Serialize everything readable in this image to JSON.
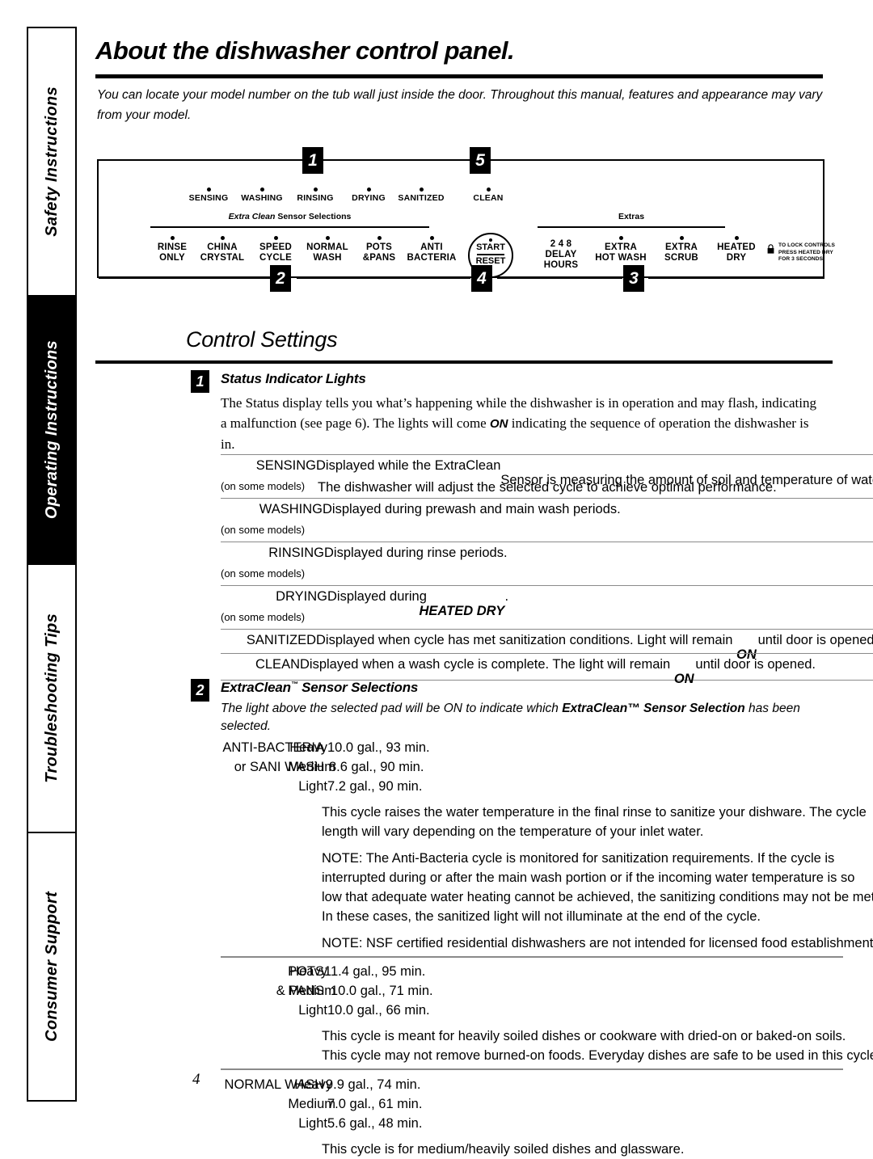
{
  "sidebar": {
    "tabs": [
      {
        "label": "Safety Instructions",
        "active": false
      },
      {
        "label": "Operating Instructions",
        "active": true
      },
      {
        "label": "Troubleshooting Tips",
        "active": false
      },
      {
        "label": "Consumer Support",
        "active": false
      }
    ]
  },
  "page": {
    "title": "About the dishwasher control panel.",
    "intro": "You can locate your model number on the tub wall just inside the door. Throughout this manual, features and appearance may vary from your model.",
    "page_number": "4"
  },
  "control_panel": {
    "callouts": [
      "1",
      "5",
      "2",
      "4",
      "3"
    ],
    "status_lights": [
      "SENSING",
      "WASHING",
      "RINSING",
      "DRYING",
      "SANITIZED"
    ],
    "clean_light": "CLEAN",
    "sensor_group_label_italic": "Extra Clean",
    "sensor_group_label_rest": " Sensor Selections",
    "extras_group_label": "Extras",
    "pads": [
      {
        "line1": "RINSE",
        "line2": "ONLY"
      },
      {
        "line1": "CHINA",
        "line2": "CRYSTAL"
      },
      {
        "line1": "SPEED",
        "line2": "CYCLE"
      },
      {
        "line1": "NORMAL",
        "line2": "WASH"
      },
      {
        "line1": "POTS",
        "line2": "&PANS"
      },
      {
        "line1": "ANTI",
        "line2": "BACTERIA"
      }
    ],
    "start_reset": {
      "start": "START",
      "reset": "RESET"
    },
    "delay": {
      "numbers": "2  4  8",
      "line2": "DELAY",
      "line3": "HOURS"
    },
    "extras_pads": [
      {
        "line1": "EXTRA",
        "line2": "HOT WASH"
      },
      {
        "line1": "EXTRA",
        "line2": "SCRUB"
      },
      {
        "line1": "HEATED",
        "line2": "DRY"
      }
    ],
    "lock_note": [
      "TO LOCK CONTROLS",
      "PRESS HEATED DRY",
      "FOR 3 SECONDS"
    ],
    "lock_icon": "padlock-icon"
  },
  "control_settings": {
    "heading": "Control Settings",
    "section1": {
      "number": "1",
      "title": "Status Indicator Lights",
      "body_part1": "The Status display tells you what’s happening while the dishwasher is in operation and may flash, indicating a malfunction (see page 6). The lights will come ",
      "body_on": "ON",
      "body_part2": " indicating the sequence of operation the dishwasher is in.",
      "rows": [
        {
          "name": "SENSING",
          "models": "(on some models)",
          "desc_line1_a": "Displayed while the ExtraClean",
          "desc_line1_b": "Sensor is measuring the amount of soil and temperature of water.",
          "desc_line2": "The dishwasher will adjust the selected cycle to achieve optimal performance."
        },
        {
          "name": "WASHING",
          "models": "(on some models)",
          "desc_line1_a": "Displayed during prewash and main wash periods.",
          "desc_line1_b": "",
          "desc_line2": ""
        },
        {
          "name": "RINSING",
          "models": "(on some models)",
          "desc_line1_a": "Displayed during rinse periods.",
          "desc_line1_b": "",
          "desc_line2": ""
        },
        {
          "name": "DRYING",
          "models": "(on some models)",
          "desc_line1_a": "Displayed during ",
          "desc_bold": "HEATED DRY",
          "desc_line1_b": ".",
          "desc_line2": ""
        },
        {
          "name": "SANITIZED",
          "models": "",
          "desc_line1_a": "Displayed when cycle has met sanitization conditions. Light will remain ",
          "desc_on": "ON",
          "desc_line1_b": " until door is opened.",
          "desc_line2": ""
        },
        {
          "name": "CLEAN",
          "models": "",
          "desc_line1_a": "Displayed when a wash cycle is complete. The light will remain ",
          "desc_on": "ON",
          "desc_line1_b": " until door is opened.",
          "desc_line2": ""
        }
      ]
    },
    "section2": {
      "number": "2",
      "title_main": "ExtraClean",
      "title_sup": "™",
      "title_rest": " Sensor Selections",
      "intro_a": "The light above the selected pad will be ON to indicate which ",
      "intro_bold": "ExtraClean™ Sensor Selection",
      "intro_b": " has been selected.",
      "cycles": [
        {
          "name_line1": "ANTI-BACTERIA",
          "name_line2": "or SANI WASH",
          "loads": [
            {
              "load": "Heavy",
              "value": "10.0 gal., 93 min."
            },
            {
              "load": "Medium",
              "value": "8.6 gal., 90 min."
            },
            {
              "load": "Light",
              "value": "7.2 gal., 90 min."
            }
          ],
          "paragraphs": [
            "This cycle raises the water temperature in the final rinse to sanitize your dishware. The cycle",
            "length will vary depending on the temperature of your inlet water.",
            "NOTE: The Anti-Bacteria cycle is monitored for sanitization requirements. If the cycle is",
            "interrupted during or after the main wash portion or if the incoming water temperature is so",
            "low that adequate water heating cannot be achieved, the sanitizing conditions may not be met.",
            "In these cases, the sanitized light will not illuminate at the end of the cycle.",
            "NOTE: NSF certified residential dishwashers are not intended for licensed food establishments."
          ]
        },
        {
          "name_line1": "POTS",
          "name_line2": "& PANS",
          "loads": [
            {
              "load": "Heavy",
              "value": "11.4 gal., 95 min."
            },
            {
              "load": "Medium",
              "value": "10.0 gal., 71 min."
            },
            {
              "load": "Light",
              "value": "10.0 gal., 66 min."
            }
          ],
          "paragraphs": [
            "This cycle is meant for heavily soiled dishes or cookware with dried-on or baked-on soils.",
            "This cycle may not remove burned-on foods. Everyday dishes are safe to be used in this cycle."
          ]
        },
        {
          "name_line1": "NORMAL WASH",
          "name_line2": "",
          "loads": [
            {
              "load": "Heavy",
              "value": "9.9 gal., 74 min."
            },
            {
              "load": "Medium",
              "value": "7.0 gal., 61 min."
            },
            {
              "load": "Light",
              "value": "5.6 gal., 48 min."
            }
          ],
          "paragraphs": [
            "This cycle is for medium/heavily soiled dishes and glassware."
          ]
        }
      ]
    }
  }
}
